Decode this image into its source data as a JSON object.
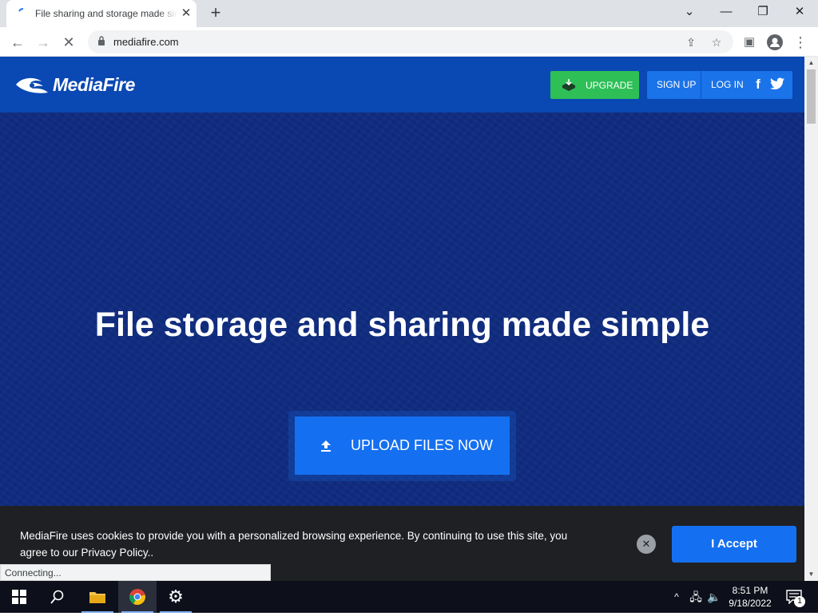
{
  "browser": {
    "tab_title": "File sharing and storage made simple",
    "url": "mediafire.com",
    "status": "Connecting..."
  },
  "header": {
    "logo_text": "MediaFire",
    "upgrade_label": "UPGRADE",
    "signup_label": "SIGN UP",
    "login_label": "LOG IN",
    "facebook_glyph": "f"
  },
  "hero": {
    "title": "File storage and sharing made simple",
    "upload_label": "UPLOAD FILES NOW"
  },
  "cookie_banner": {
    "text": "MediaFire uses cookies to provide you with a personalized browsing experience. By continuing to use this site, you agree to our Privacy Policy..",
    "accept_label": "I Accept"
  },
  "taskbar": {
    "time": "8:51 PM",
    "date": "9/18/2022",
    "notification_count": "1"
  },
  "colors": {
    "header_blue": "#0a48b3",
    "hero_navy": "#0f2c80",
    "upgrade_green": "#2ebf57",
    "button_blue": "#1470f0",
    "banner_dark": "#1f2023"
  }
}
